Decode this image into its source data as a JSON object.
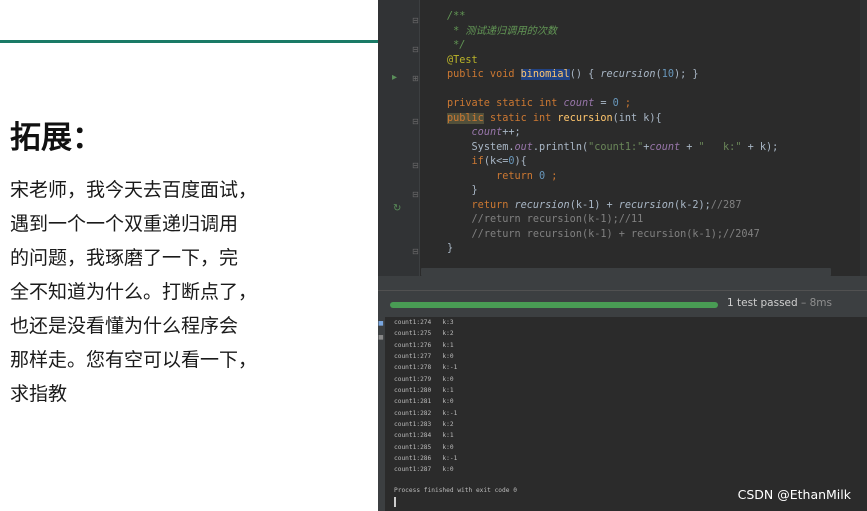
{
  "slide": {
    "title": "拓展：",
    "body_lines": [
      "宋老师，我今天去百度面试，",
      "遇到一个一个双重递归调用",
      "的问题，我琢磨了一下，完",
      "全不知道为什么。打断点了，",
      "也还是没看懂为什么程序会",
      "那样走。您有空可以看一下，",
      "求指教"
    ]
  },
  "editor": {
    "lines": {
      "l1": "/**",
      "l2": " * 测试递归调用的次数",
      "l3": " */",
      "l4": "@Test",
      "l5_kw": "public void ",
      "l5_fn": "binomial",
      "l5_rest1": "() { ",
      "l5_call": "recursion",
      "l5_rest2": "(",
      "l5_num": "10",
      "l5_rest3": "); }",
      "l6_kw": "private static int ",
      "l6_fld": "count",
      "l6_eq": " = ",
      "l6_num": "0",
      "l6_end": " ;",
      "l7_pub": "public",
      "l7_kw": " static int ",
      "l7_fn": "recursion",
      "l7_rest": "(int k){",
      "l8_fld": "count",
      "l8_rest": "++;",
      "l9_a": "System.",
      "l9_out": "out",
      "l9_b": ".println(",
      "l9_str": "\"count1:\"",
      "l9_c": "+",
      "l9_fld": "count",
      "l9_d": " + ",
      "l9_str2": "\"   k:\"",
      "l9_e": " + k);",
      "l10_kw": "if",
      "l10_rest": "(k<=",
      "l10_num": "0",
      "l10_end": "){",
      "l11_kw": "return ",
      "l11_num": "0",
      "l11_end": " ;",
      "l12": "}",
      "l13_kw": "return ",
      "l13_a": "recursion",
      "l13_b": "(k-1) + ",
      "l13_c": "recursion",
      "l13_d": "(k-2);",
      "l13_cm": "//287",
      "l14": "//return recursion(k-1);//11",
      "l15": "//return recursion(k-1) + recursion(k-1);//2047",
      "l16": "}"
    }
  },
  "run": {
    "status": "1 test passed",
    "time": " – 8ms"
  },
  "console": {
    "lines": [
      "count1:274   k:3",
      "count1:275   k:2",
      "count1:276   k:1",
      "count1:277   k:0",
      "count1:278   k:-1",
      "count1:279   k:0",
      "count1:280   k:1",
      "count1:281   k:0",
      "count1:282   k:-1",
      "count1:283   k:2",
      "count1:284   k:1",
      "count1:285   k:0",
      "count1:286   k:-1",
      "count1:287   k:0"
    ],
    "finish": "Process finished with exit code 0"
  },
  "watermark": "CSDN @EthanMilk",
  "colors": {
    "accent_rule": "#1a7a66",
    "progress": "#499c54",
    "editor_bg": "#2b2b2b"
  }
}
